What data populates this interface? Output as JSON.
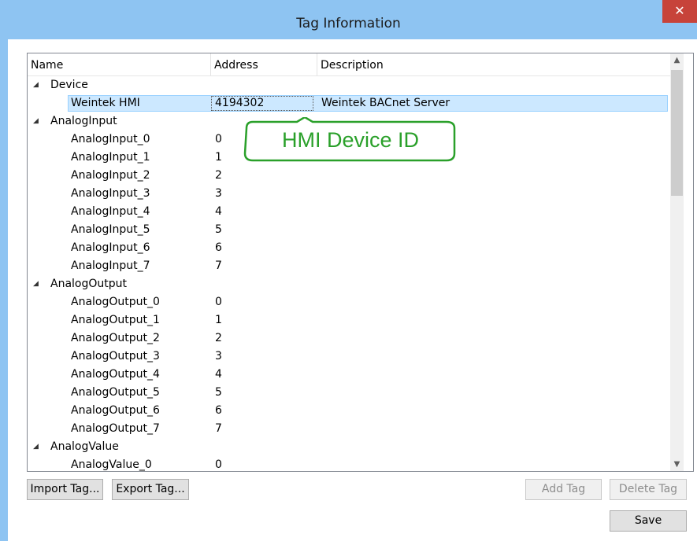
{
  "window": {
    "title": "Tag Information",
    "close_glyph": "✕"
  },
  "columns": {
    "name": "Name",
    "address": "Address",
    "description": "Description"
  },
  "tree": {
    "groups": [
      {
        "label": "Device",
        "items": [
          {
            "name": "Weintek HMI",
            "address": "4194302",
            "description": "Weintek BACnet Server",
            "selected": true
          }
        ]
      },
      {
        "label": "AnalogInput",
        "items": [
          {
            "name": "AnalogInput_0",
            "address": "0"
          },
          {
            "name": "AnalogInput_1",
            "address": "1"
          },
          {
            "name": "AnalogInput_2",
            "address": "2"
          },
          {
            "name": "AnalogInput_3",
            "address": "3"
          },
          {
            "name": "AnalogInput_4",
            "address": "4"
          },
          {
            "name": "AnalogInput_5",
            "address": "5"
          },
          {
            "name": "AnalogInput_6",
            "address": "6"
          },
          {
            "name": "AnalogInput_7",
            "address": "7"
          }
        ]
      },
      {
        "label": "AnalogOutput",
        "items": [
          {
            "name": "AnalogOutput_0",
            "address": "0"
          },
          {
            "name": "AnalogOutput_1",
            "address": "1"
          },
          {
            "name": "AnalogOutput_2",
            "address": "2"
          },
          {
            "name": "AnalogOutput_3",
            "address": "3"
          },
          {
            "name": "AnalogOutput_4",
            "address": "4"
          },
          {
            "name": "AnalogOutput_5",
            "address": "5"
          },
          {
            "name": "AnalogOutput_6",
            "address": "6"
          },
          {
            "name": "AnalogOutput_7",
            "address": "7"
          }
        ]
      },
      {
        "label": "AnalogValue",
        "items": [
          {
            "name": "AnalogValue_0",
            "address": "0"
          }
        ]
      }
    ]
  },
  "annotation": {
    "text": "HMI Device ID",
    "color": "#2aa02a"
  },
  "buttons": {
    "import_tag": "Import Tag...",
    "export_tag": "Export Tag...",
    "add_tag": "Add Tag",
    "delete_tag": "Delete Tag",
    "save": "Save"
  },
  "colors": {
    "title_bar": "#8ec4f2",
    "close_button": "#c7433a",
    "selection": "#cce8ff"
  }
}
